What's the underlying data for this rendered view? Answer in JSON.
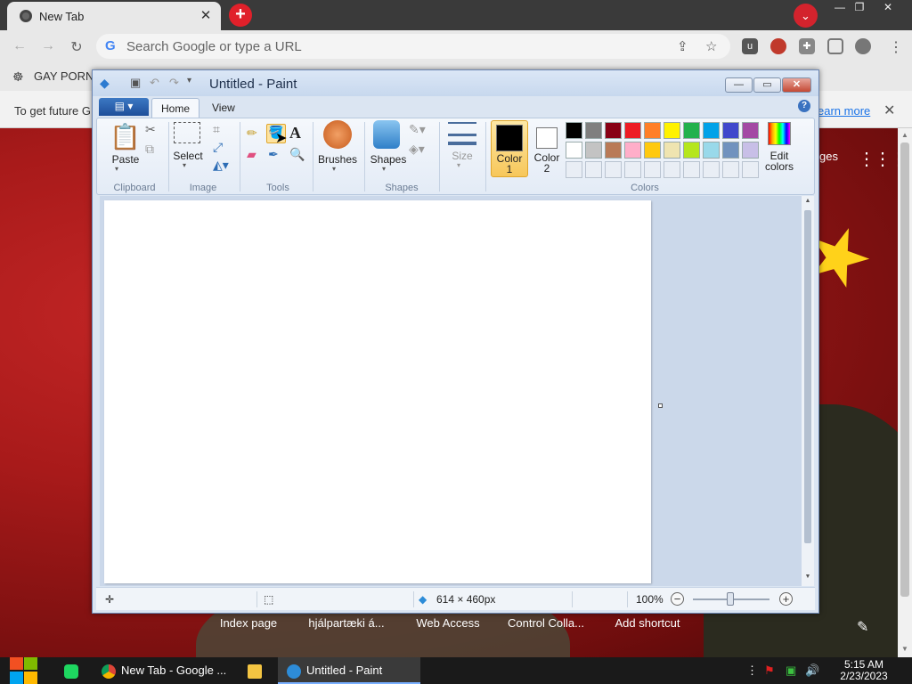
{
  "chrome": {
    "tab_title": "New Tab",
    "tab_close": "✕",
    "newtab_symbol": "+",
    "omnibox_placeholder": "Search Google or type a URL",
    "bookmark_label": "GAY PORN",
    "infobar_text": "To get future G",
    "infobar_link": "earn more",
    "images_link": "ges",
    "shortcuts": [
      "Index page",
      "hjálpartæki á...",
      "Web Access",
      "Control Colla...",
      "Add shortcut"
    ]
  },
  "paint": {
    "window_title": "Untitled - Paint",
    "tabs": {
      "home": "Home",
      "view": "View"
    },
    "groups": {
      "clipboard": "Clipboard",
      "image": "Image",
      "tools": "Tools",
      "shapes": "Shapes",
      "colors": "Colors"
    },
    "buttons": {
      "paste": "Paste",
      "select": "Select",
      "brushes": "Brushes",
      "shapes": "Shapes",
      "size": "Size",
      "color1_line1": "Color",
      "color1_line2": "1",
      "color2_line1": "Color",
      "color2_line2": "2",
      "edit_colors_line1": "Edit",
      "edit_colors_line2": "colors"
    },
    "color1": "#000000",
    "color2": "#ffffff",
    "palette_row1": [
      "#000000",
      "#7f7f7f",
      "#880015",
      "#ed1c24",
      "#ff7f27",
      "#fff200",
      "#22b14c",
      "#00a2e8",
      "#3f48cc",
      "#a349a4"
    ],
    "palette_row2": [
      "#ffffff",
      "#c3c3c3",
      "#b97a57",
      "#ffaec9",
      "#ffc90e",
      "#efe4b0",
      "#b5e61d",
      "#99d9ea",
      "#7092be",
      "#c8bfe7"
    ],
    "status": {
      "image_size": "614 × 460px",
      "zoom": "100%"
    }
  },
  "taskbar": {
    "apps": [
      {
        "label": "New Tab - Google ...",
        "color": "#db4437"
      },
      {
        "label": "Untitled - Paint",
        "color": "#2d8cd8"
      }
    ],
    "time": "5:15 AM",
    "date": "2/23/2023"
  }
}
